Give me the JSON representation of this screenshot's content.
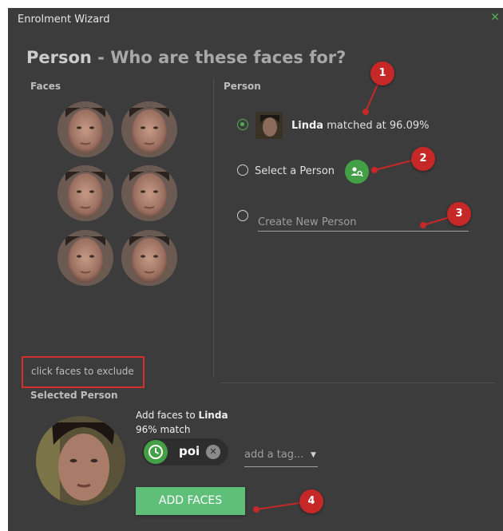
{
  "window": {
    "title": "Enrolment Wizard",
    "close_glyph": "✕"
  },
  "heading": {
    "main": "Person",
    "separator": " - ",
    "sub": "Who are these faces for?"
  },
  "faces_panel": {
    "label": "Faces",
    "hint": "click faces to exclude"
  },
  "person_panel": {
    "label": "Person",
    "matched": {
      "name": "Linda",
      "text": " matched at 96.09%"
    },
    "select_label": "Select a Person",
    "create_placeholder": "Create New Person"
  },
  "selected_person": {
    "label": "Selected Person",
    "add_prefix": "Add faces to ",
    "name": "Linda",
    "match": "96% match",
    "tag_chip": "poi",
    "tag_placeholder": "add a tag...",
    "add_button": "ADD FACES"
  },
  "markers": [
    "1",
    "2",
    "3",
    "4"
  ],
  "colors": {
    "accent": "#4caf50",
    "marker": "#c62828",
    "add_button": "#5fbf78"
  },
  "icons": [
    "close-icon",
    "search-person-icon",
    "clock-icon",
    "remove-tag-icon",
    "dropdown-arrow-icon"
  ]
}
